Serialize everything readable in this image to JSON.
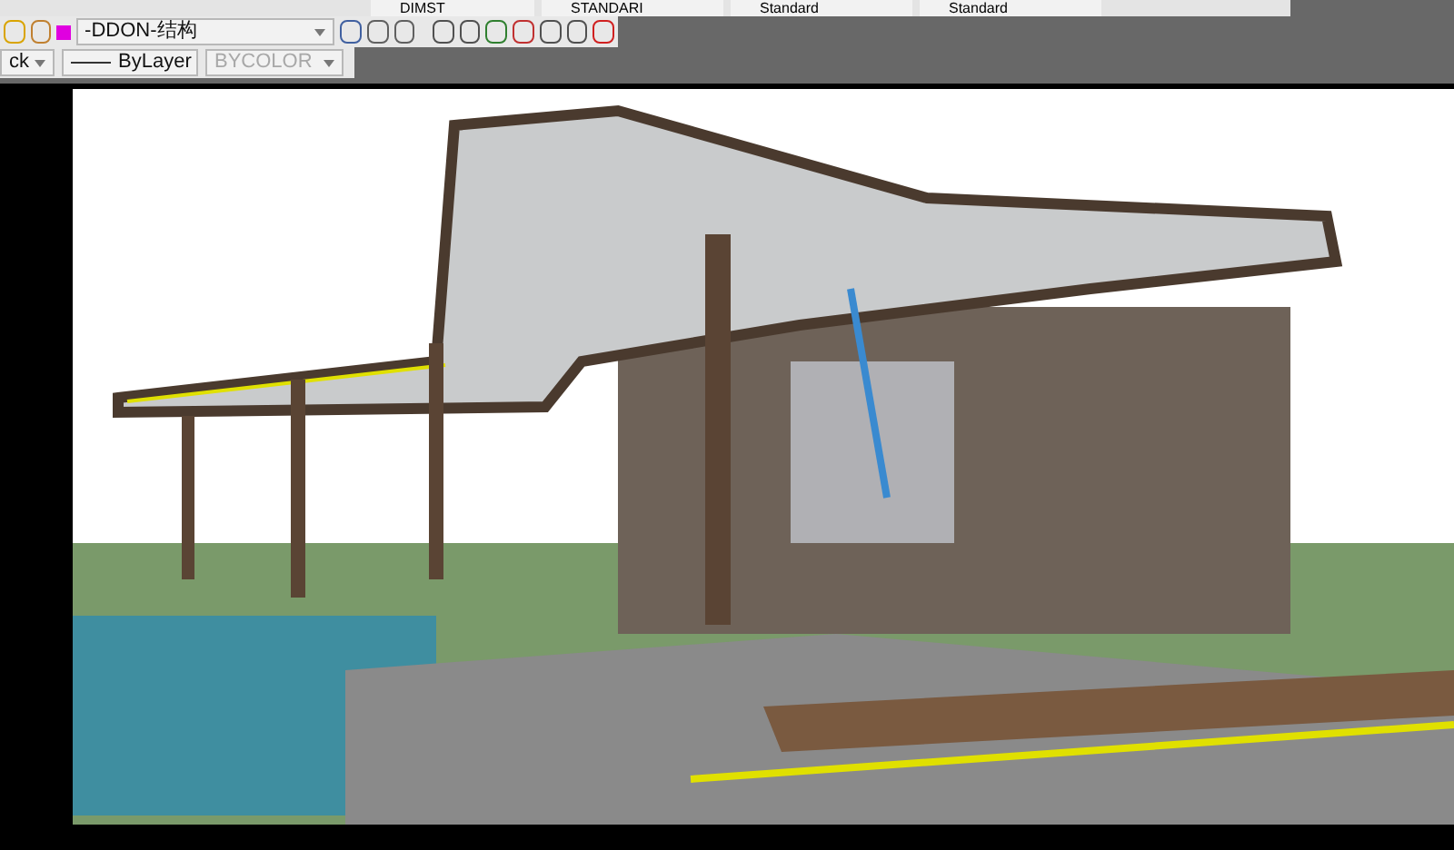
{
  "toolbar_top": {
    "dimstyle": "DIMST",
    "textstyle": "STANDARI",
    "tablestyle": "Standard",
    "multileaderstyle": "Standard"
  },
  "layer_bar": {
    "layer": "-DDON-结构"
  },
  "properties_bar": {
    "linetype_cut": "ck",
    "lineweight": "ByLayer",
    "plotstyle": "BYCOLOR"
  }
}
